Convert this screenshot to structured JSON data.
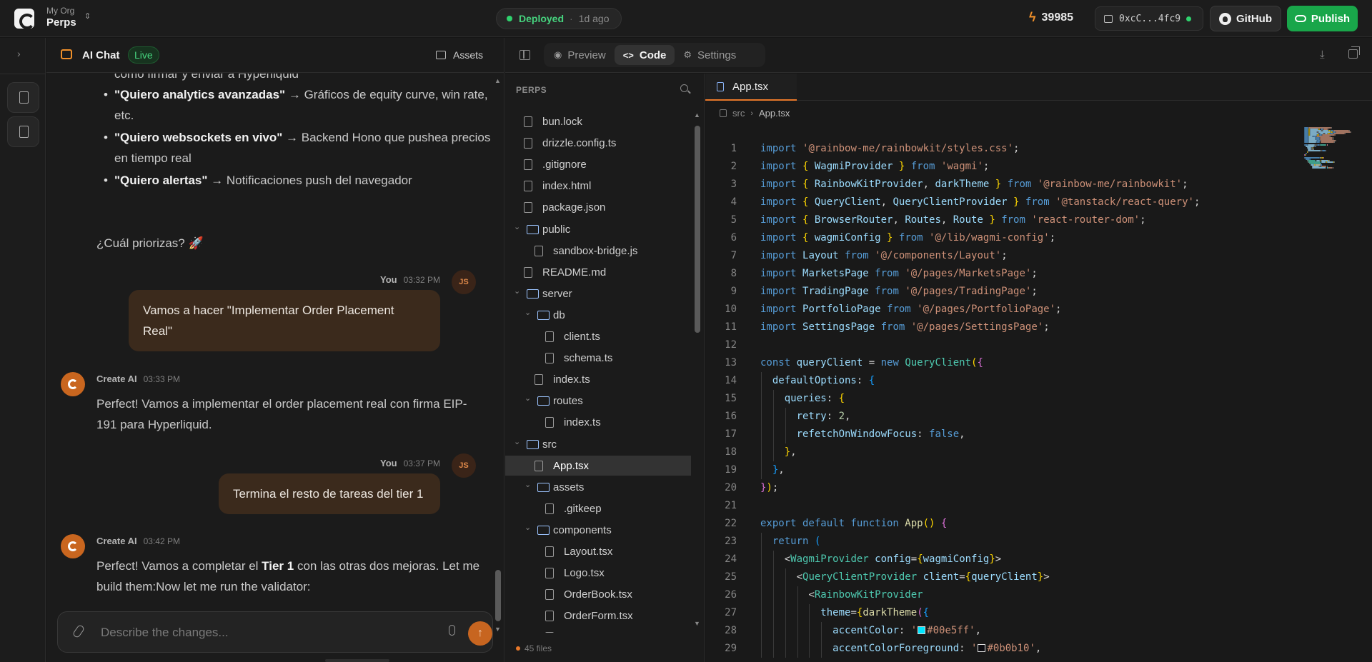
{
  "topbar": {
    "org_name": "My Org",
    "project_name": "Perps",
    "deploy_status": "Deployed",
    "deploy_time": "1d ago",
    "credits": "39985",
    "wallet": "0xcC...4fc9",
    "github_label": "GitHub",
    "publish_label": "Publish",
    "colors": {
      "deployed": "#46d37e",
      "publish": "#19a64a",
      "accent": "#e8782a"
    }
  },
  "chat": {
    "title": "AI Chat",
    "live_badge": "Live",
    "assets_label": "Assets",
    "top_partial_text": "como firmar y enviar a Hyperliquid",
    "bullets": [
      {
        "bold": "\"Quiero analytics avanzadas\"",
        "text": " → Gráficos de equity curve, win rate, etc."
      },
      {
        "bold": "\"Quiero websockets en vivo\"",
        "text": " → Backend Hono que pushea precios en tiempo real"
      },
      {
        "bold": "\"Quiero alertas\"",
        "text": " → Notificaciones push del navegador"
      }
    ],
    "question": "¿Cuál priorizas? 🚀",
    "messages": [
      {
        "author": "You",
        "time": "03:32 PM",
        "avatar": "JS",
        "text": "Vamos a hacer \"Implementar Order Placement Real\""
      },
      {
        "author": "Create AI",
        "time": "03:33 PM",
        "text": "Perfect! Vamos a implementar el order placement real con firma EIP-191 para Hyperliquid."
      },
      {
        "author": "You",
        "time": "03:37 PM",
        "avatar": "JS",
        "text": "Termina el resto de tareas del tier 1"
      },
      {
        "author": "Create AI",
        "time": "03:42 PM",
        "text_before": "Perfect! Vamos a completar el ",
        "text_bold": "Tier 1",
        "text_after": " con las otras dos mejoras. Let me build them:Now let me run the validator:"
      }
    ],
    "input_placeholder": "Describe the changes..."
  },
  "pane": {
    "tabs": [
      {
        "label": "Preview",
        "icon": "eye-icon",
        "active": false
      },
      {
        "label": "Code",
        "icon": "code-icon",
        "active": true
      },
      {
        "label": "Settings",
        "icon": "gear-icon",
        "active": false
      }
    ]
  },
  "explorer": {
    "title": "PERPS",
    "file_count": "45 files",
    "tree": [
      {
        "name": "bun.lock",
        "type": "file",
        "depth": 0
      },
      {
        "name": "drizzle.config.ts",
        "type": "file",
        "depth": 0
      },
      {
        "name": ".gitignore",
        "type": "file",
        "depth": 0
      },
      {
        "name": "index.html",
        "type": "file",
        "depth": 0
      },
      {
        "name": "package.json",
        "type": "file",
        "depth": 0
      },
      {
        "name": "public",
        "type": "folder",
        "depth": 0
      },
      {
        "name": "sandbox-bridge.js",
        "type": "file",
        "depth": 1
      },
      {
        "name": "README.md",
        "type": "file",
        "depth": 0
      },
      {
        "name": "server",
        "type": "folder",
        "depth": 0
      },
      {
        "name": "db",
        "type": "folder",
        "depth": 1
      },
      {
        "name": "client.ts",
        "type": "file",
        "depth": 2
      },
      {
        "name": "schema.ts",
        "type": "file",
        "depth": 2
      },
      {
        "name": "index.ts",
        "type": "file",
        "depth": 1
      },
      {
        "name": "routes",
        "type": "folder",
        "depth": 1
      },
      {
        "name": "index.ts",
        "type": "file",
        "depth": 2
      },
      {
        "name": "src",
        "type": "folder",
        "depth": 0
      },
      {
        "name": "App.tsx",
        "type": "file",
        "depth": 1,
        "selected": true
      },
      {
        "name": "assets",
        "type": "folder",
        "depth": 1
      },
      {
        "name": ".gitkeep",
        "type": "file",
        "depth": 2
      },
      {
        "name": "components",
        "type": "folder",
        "depth": 1
      },
      {
        "name": "Layout.tsx",
        "type": "file",
        "depth": 2
      },
      {
        "name": "Logo.tsx",
        "type": "file",
        "depth": 2
      },
      {
        "name": "OrderBook.tsx",
        "type": "file",
        "depth": 2
      },
      {
        "name": "OrderForm.tsx",
        "type": "file",
        "depth": 2
      },
      {
        "name": "",
        "type": "file",
        "depth": 2
      }
    ]
  },
  "editor": {
    "tab_label": "App.tsx",
    "breadcrumb": [
      "src",
      "App.tsx"
    ],
    "lines": [
      [
        [
          "kw",
          "import "
        ],
        [
          "str",
          "'@rainbow-me/rainbowkit/styles.css'"
        ],
        [
          "pl",
          ";"
        ]
      ],
      [
        [
          "kw",
          "import "
        ],
        [
          "br1",
          "{ "
        ],
        [
          "id",
          "WagmiProvider"
        ],
        [
          "br1",
          " } "
        ],
        [
          "kw",
          "from "
        ],
        [
          "str",
          "'wagmi'"
        ],
        [
          "pl",
          ";"
        ]
      ],
      [
        [
          "kw",
          "import "
        ],
        [
          "br1",
          "{ "
        ],
        [
          "id",
          "RainbowKitProvider"
        ],
        [
          "pl",
          ", "
        ],
        [
          "id",
          "darkTheme"
        ],
        [
          "br1",
          " } "
        ],
        [
          "kw",
          "from "
        ],
        [
          "str",
          "'@rainbow-me/rainbowkit'"
        ],
        [
          "pl",
          ";"
        ]
      ],
      [
        [
          "kw",
          "import "
        ],
        [
          "br1",
          "{ "
        ],
        [
          "id",
          "QueryClient"
        ],
        [
          "pl",
          ", "
        ],
        [
          "id",
          "QueryClientProvider"
        ],
        [
          "br1",
          " } "
        ],
        [
          "kw",
          "from "
        ],
        [
          "str",
          "'@tanstack/react-query'"
        ],
        [
          "pl",
          ";"
        ]
      ],
      [
        [
          "kw",
          "import "
        ],
        [
          "br1",
          "{ "
        ],
        [
          "id",
          "BrowserRouter"
        ],
        [
          "pl",
          ", "
        ],
        [
          "id",
          "Routes"
        ],
        [
          "pl",
          ", "
        ],
        [
          "id",
          "Route"
        ],
        [
          "br1",
          " } "
        ],
        [
          "kw",
          "from "
        ],
        [
          "str",
          "'react-router-dom'"
        ],
        [
          "pl",
          ";"
        ]
      ],
      [
        [
          "kw",
          "import "
        ],
        [
          "br1",
          "{ "
        ],
        [
          "id",
          "wagmiConfig"
        ],
        [
          "br1",
          " } "
        ],
        [
          "kw",
          "from "
        ],
        [
          "str",
          "'@/lib/wagmi-config'"
        ],
        [
          "pl",
          ";"
        ]
      ],
      [
        [
          "kw",
          "import "
        ],
        [
          "id",
          "Layout"
        ],
        [
          "kw",
          " from "
        ],
        [
          "str",
          "'@/components/Layout'"
        ],
        [
          "pl",
          ";"
        ]
      ],
      [
        [
          "kw",
          "import "
        ],
        [
          "id",
          "MarketsPage"
        ],
        [
          "kw",
          " from "
        ],
        [
          "str",
          "'@/pages/MarketsPage'"
        ],
        [
          "pl",
          ";"
        ]
      ],
      [
        [
          "kw",
          "import "
        ],
        [
          "id",
          "TradingPage"
        ],
        [
          "kw",
          " from "
        ],
        [
          "str",
          "'@/pages/TradingPage'"
        ],
        [
          "pl",
          ";"
        ]
      ],
      [
        [
          "kw",
          "import "
        ],
        [
          "id",
          "PortfolioPage"
        ],
        [
          "kw",
          " from "
        ],
        [
          "str",
          "'@/pages/PortfolioPage'"
        ],
        [
          "pl",
          ";"
        ]
      ],
      [
        [
          "kw",
          "import "
        ],
        [
          "id",
          "SettingsPage"
        ],
        [
          "kw",
          " from "
        ],
        [
          "str",
          "'@/pages/SettingsPage'"
        ],
        [
          "pl",
          ";"
        ]
      ],
      [],
      [
        [
          "kw",
          "const "
        ],
        [
          "id",
          "queryClient"
        ],
        [
          "pl",
          " = "
        ],
        [
          "kw",
          "new "
        ],
        [
          "cls",
          "QueryClient"
        ],
        [
          "br1",
          "("
        ],
        [
          "br2",
          "{"
        ]
      ],
      [
        [
          "pl",
          "  "
        ],
        [
          "id",
          "defaultOptions"
        ],
        [
          "pl",
          ": "
        ],
        [
          "br3",
          "{"
        ]
      ],
      [
        [
          "pl",
          "    "
        ],
        [
          "id",
          "queries"
        ],
        [
          "pl",
          ": "
        ],
        [
          "br1",
          "{"
        ]
      ],
      [
        [
          "pl",
          "      "
        ],
        [
          "id",
          "retry"
        ],
        [
          "pl",
          ": "
        ],
        [
          "num",
          "2"
        ],
        [
          "pl",
          ","
        ]
      ],
      [
        [
          "pl",
          "      "
        ],
        [
          "id",
          "refetchOnWindowFocus"
        ],
        [
          "pl",
          ": "
        ],
        [
          "kw",
          "false"
        ],
        [
          "pl",
          ","
        ]
      ],
      [
        [
          "pl",
          "    "
        ],
        [
          "br1",
          "}"
        ],
        [
          "pl",
          ","
        ]
      ],
      [
        [
          "pl",
          "  "
        ],
        [
          "br3",
          "}"
        ],
        [
          "pl",
          ","
        ]
      ],
      [
        [
          "br2",
          "}"
        ],
        [
          "br1",
          ")"
        ],
        [
          "pl",
          ";"
        ]
      ],
      [],
      [
        [
          "kw",
          "export default function "
        ],
        [
          "fn",
          "App"
        ],
        [
          "br1",
          "() "
        ],
        [
          "br2",
          "{"
        ]
      ],
      [
        [
          "pl",
          "  "
        ],
        [
          "kw",
          "return "
        ],
        [
          "br3",
          "("
        ]
      ],
      [
        [
          "pl",
          "    "
        ],
        [
          "pl",
          "<"
        ],
        [
          "cls",
          "WagmiProvider"
        ],
        [
          "pl",
          " "
        ],
        [
          "id",
          "config"
        ],
        [
          "pl",
          "="
        ],
        [
          "br1",
          "{"
        ],
        [
          "id",
          "wagmiConfig"
        ],
        [
          "br1",
          "}"
        ],
        [
          "pl",
          ">"
        ]
      ],
      [
        [
          "pl",
          "      "
        ],
        [
          "pl",
          "<"
        ],
        [
          "cls",
          "QueryClientProvider"
        ],
        [
          "pl",
          " "
        ],
        [
          "id",
          "client"
        ],
        [
          "pl",
          "="
        ],
        [
          "br1",
          "{"
        ],
        [
          "id",
          "queryClient"
        ],
        [
          "br1",
          "}"
        ],
        [
          "pl",
          ">"
        ]
      ],
      [
        [
          "pl",
          "        "
        ],
        [
          "pl",
          "<"
        ],
        [
          "cls",
          "RainbowKitProvider"
        ]
      ],
      [
        [
          "pl",
          "          "
        ],
        [
          "id",
          "theme"
        ],
        [
          "pl",
          "="
        ],
        [
          "br1",
          "{"
        ],
        [
          "fn",
          "darkTheme"
        ],
        [
          "br2",
          "("
        ],
        [
          "br3",
          "{"
        ]
      ],
      [
        [
          "pl",
          "            "
        ],
        [
          "id",
          "accentColor"
        ],
        [
          "pl",
          ": "
        ],
        [
          "str",
          "'"
        ],
        [
          "swatch",
          "#00e5ff"
        ],
        [
          "str",
          "#00e5ff'"
        ],
        [
          "pl",
          ","
        ]
      ],
      [
        [
          "pl",
          "            "
        ],
        [
          "id",
          "accentColorForeground"
        ],
        [
          "pl",
          ": "
        ],
        [
          "str",
          "'"
        ],
        [
          "swatch",
          "#0b0b10"
        ],
        [
          "str",
          "#0b0b10'"
        ],
        [
          "pl",
          ","
        ]
      ]
    ]
  }
}
